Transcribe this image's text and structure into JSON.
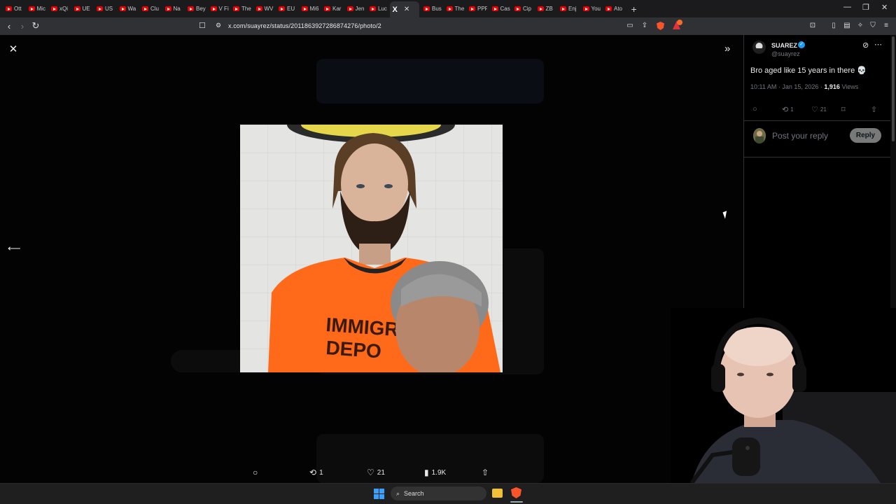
{
  "browser": {
    "tabs": [
      {
        "label": "Ott"
      },
      {
        "label": "Mic"
      },
      {
        "label": "xQi"
      },
      {
        "label": "UE"
      },
      {
        "label": "US"
      },
      {
        "label": "Wa"
      },
      {
        "label": "Clu"
      },
      {
        "label": "Na"
      },
      {
        "label": "Bey"
      },
      {
        "label": "V Fi"
      },
      {
        "label": "The"
      },
      {
        "label": "WV"
      },
      {
        "label": "EU"
      },
      {
        "label": "Mi6"
      },
      {
        "label": "Kar"
      },
      {
        "label": "Jen"
      },
      {
        "label": "Luc"
      }
    ],
    "active_tab": {
      "icon": "X",
      "close": "✕"
    },
    "tabs_after": [
      {
        "label": "Bus"
      },
      {
        "label": "The"
      },
      {
        "label": "PPF"
      },
      {
        "label": "Cas"
      },
      {
        "label": "Cip"
      },
      {
        "label": "ZB"
      },
      {
        "label": "Enj"
      },
      {
        "label": "You"
      },
      {
        "label": "Ato"
      }
    ],
    "new_tab": "+",
    "url": "x.com/suayrez/status/2011863927286874276/photo/2"
  },
  "media_bar": {
    "reply_count": "",
    "repost_count": "1",
    "like_count": "21",
    "views_count": "1.9K"
  },
  "tweet": {
    "display_name": "SUAREZ",
    "handle": "@suayrez",
    "text": "Bro aged like 15 years in there 💀",
    "time": "10:11 AM · Jan 15, 2026 · ",
    "views_value": "1,916",
    "views_label": " Views",
    "repost_count": "1",
    "like_count": "21"
  },
  "reply": {
    "placeholder": "Post your reply",
    "button": "Reply"
  },
  "taskbar": {
    "search_label": "Search"
  },
  "icons": {
    "close": "close-icon",
    "back": "arrow-left-icon",
    "expand": "double-chevron-right-icon",
    "reply": "reply-icon",
    "repost": "repost-icon",
    "like": "heart-icon",
    "views": "views-icon",
    "share": "share-icon",
    "bookmark": "bookmark-icon"
  },
  "colors": {
    "accent": "#1d9bf0",
    "shirt": "#ff6a1a",
    "muted": "#71767b"
  }
}
